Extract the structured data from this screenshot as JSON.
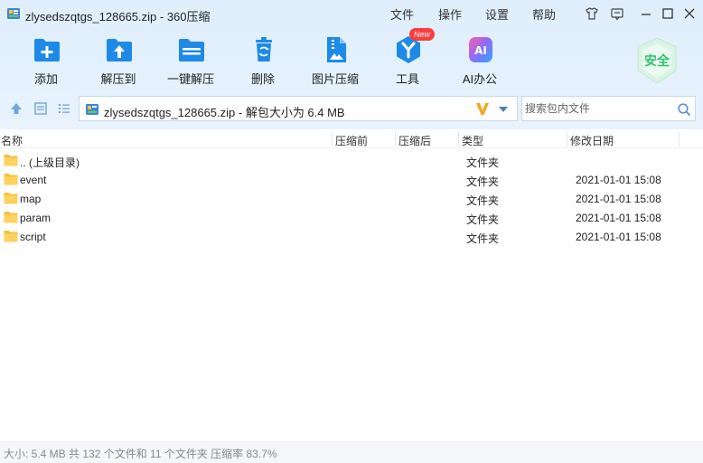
{
  "window": {
    "title": "zlysedszqtgs_128665.zip - 360压缩",
    "menu": [
      "文件",
      "操作",
      "设置",
      "帮助"
    ]
  },
  "toolbar": {
    "items": [
      {
        "label": "添加",
        "icon": "add-icon"
      },
      {
        "label": "解压到",
        "icon": "extract-to-icon"
      },
      {
        "label": "一键解压",
        "icon": "one-click-extract-icon"
      },
      {
        "label": "删除",
        "icon": "delete-icon"
      },
      {
        "label": "图片压缩",
        "icon": "image-compress-icon"
      },
      {
        "label": "工具",
        "icon": "tools-icon"
      },
      {
        "label": "AI办公",
        "icon": "ai-office-icon"
      }
    ],
    "new_badge": "New",
    "security_label": "安全"
  },
  "address": {
    "path": "zlysedszqtgs_128665.zip - 解包大小为 6.4 MB"
  },
  "search": {
    "placeholder": "搜索包内文件"
  },
  "columns": {
    "name": "名称",
    "before": "压缩前",
    "after": "压缩后",
    "type": "类型",
    "modified": "修改日期"
  },
  "files": [
    {
      "name": ".. (上级目录)",
      "type": "文件夹",
      "date": ""
    },
    {
      "name": "event",
      "type": "文件夹",
      "date": "2021-01-01 15:08"
    },
    {
      "name": "map",
      "type": "文件夹",
      "date": "2021-01-01 15:08"
    },
    {
      "name": "param",
      "type": "文件夹",
      "date": "2021-01-01 15:08"
    },
    {
      "name": "script",
      "type": "文件夹",
      "date": "2021-01-01 15:08"
    }
  ],
  "status": {
    "text": "大小: 5.4 MB 共 132 个文件和 11 个文件夹 压缩率 83.7%"
  },
  "colors": {
    "accent": "#1e8ae8",
    "folder": "#f5c242",
    "badge": "#ff3b3b",
    "security": "#2fc26b"
  }
}
